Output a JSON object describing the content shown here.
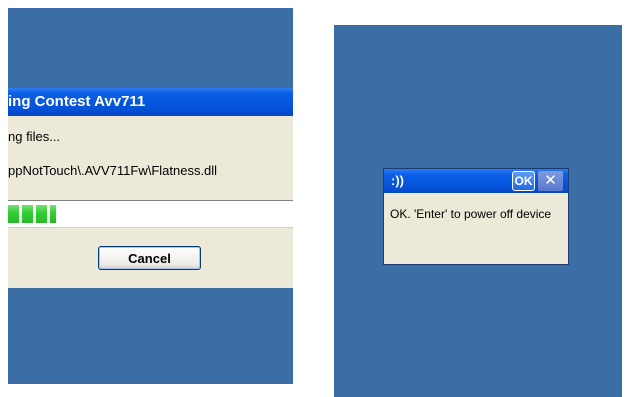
{
  "copy_dialog": {
    "title": "ing Contest Avv711",
    "status": "ng files...",
    "file_path": "ppNotTouch\\.AVV711Fw\\Flatness.dll",
    "progress_fraction": 0.17,
    "cancel_label": "Cancel"
  },
  "message_box": {
    "title": ":))",
    "ok_label": "OK",
    "close_glyph": "✕",
    "message": "OK. 'Enter' to power off device"
  },
  "colors": {
    "desktop": "#3a6ea5",
    "titlebar": "#0553d9",
    "dialog_face": "#ece9d8",
    "progress": "#2fcf2f"
  }
}
